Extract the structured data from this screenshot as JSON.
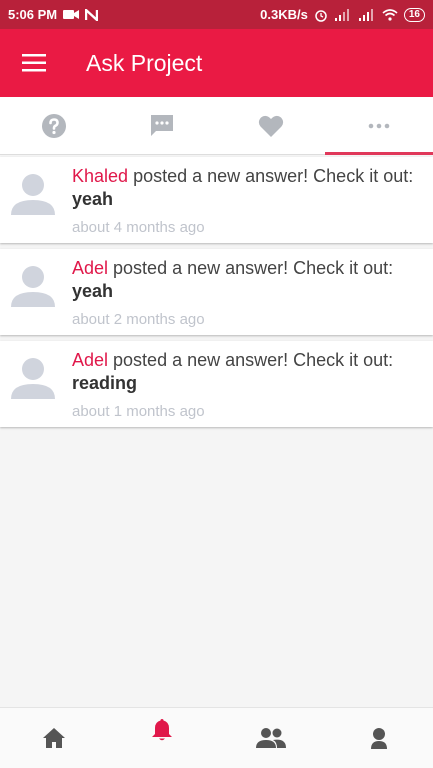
{
  "status_bar": {
    "time": "5:06 PM",
    "speed": "0.3KB/s",
    "battery": "16"
  },
  "app_bar": {
    "title": "Ask Project"
  },
  "tabs": [
    {
      "icon": "question-icon",
      "active": false
    },
    {
      "icon": "chat-icon",
      "active": false
    },
    {
      "icon": "heart-icon",
      "active": false
    },
    {
      "icon": "more-icon",
      "active": true
    }
  ],
  "notifications": [
    {
      "user": "Khaled",
      "message": " posted a new answer! Check it out: ",
      "answer": "yeah",
      "time": "about 4 months ago"
    },
    {
      "user": "Adel",
      "message": " posted a new answer! Check it out: ",
      "answer": "yeah",
      "time": "about 2 months ago"
    },
    {
      "user": "Adel",
      "message": " posted a new answer! Check it out: ",
      "answer": "reading",
      "time": "about 1 months ago"
    }
  ],
  "bottom_nav": [
    {
      "icon": "home-icon",
      "active": false
    },
    {
      "icon": "bell-icon",
      "active": true
    },
    {
      "icon": "people-icon",
      "active": false
    },
    {
      "icon": "profile-icon",
      "active": false
    }
  ],
  "colors": {
    "status_bar": "#b8213a",
    "app_bar": "#ea1a44",
    "accent": "#e0184a",
    "inactive_icon": "#b3b7bd",
    "nav_icon": "#555555"
  }
}
